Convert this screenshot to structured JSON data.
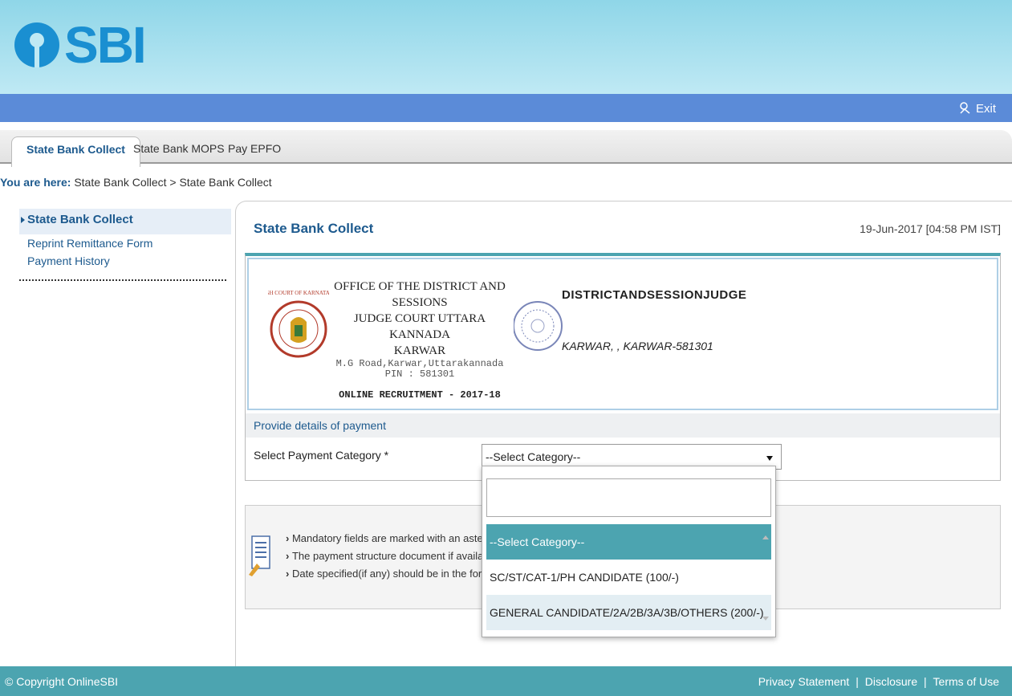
{
  "header": {
    "logo_text": "SBI",
    "exit_label": "Exit"
  },
  "tabs": [
    {
      "label": "State Bank Collect",
      "active": true
    },
    {
      "label": "State Bank MOPS",
      "active": false
    },
    {
      "label": "Pay EPFO",
      "active": false
    }
  ],
  "breadcrumb": {
    "label": "You are here:",
    "path": "State Bank Collect > State Bank Collect"
  },
  "sidebar": {
    "items": [
      {
        "label": "State Bank Collect",
        "active": true
      },
      {
        "label": "Reprint Remittance Form",
        "active": false
      },
      {
        "label": "Payment History",
        "active": false
      }
    ]
  },
  "main": {
    "title": "State Bank Collect",
    "date": "19-Jun-2017 [04:58 PM IST]",
    "office": {
      "line1": "OFFICE OF THE  DISTRICT AND SESSIONS",
      "line2": "JUDGE COURT UTTARA KANNADA",
      "line3": "KARWAR",
      "address1": "M.G Road,Karwar,Uttarakannada",
      "address2": "PIN : 581301",
      "recruitment": "ONLINE RECRUITMENT - 2017-18",
      "seal_text": "HIGH COURT OF KARNATAKA"
    },
    "department": "DISTRICTANDSESSIONJUDGE",
    "address": "KARWAR, , KARWAR-581301",
    "provide_label": "Provide details of payment",
    "category_label": "Select Payment Category *",
    "category_value": "--Select Category--",
    "notes": [
      "Mandatory fields are marked with an asteris",
      "The payment structure document if available",
      "Date specified(if any) should be in the forma"
    ]
  },
  "dropdown": {
    "search_value": "",
    "options": [
      {
        "label": "--Select Category--",
        "state": "selected"
      },
      {
        "label": "SC/ST/CAT-1/PH CANDIDATE (100/-)",
        "state": "normal"
      },
      {
        "label": "GENERAL CANDIDATE/2A/2B/3A/3B/OTHERS (200/-)",
        "state": "hover"
      }
    ]
  },
  "footer": {
    "copyright": "© Copyright OnlineSBI",
    "links": [
      "Privacy Statement",
      "Disclosure",
      "Terms of Use"
    ],
    "separator": "|"
  },
  "colors": {
    "accent": "#4ca4b0",
    "header_blue": "#5b8bd8",
    "link": "#1d5a8e",
    "sbi_blue": "#1a8fd1"
  },
  "icons": {
    "exit": "exit-icon",
    "note": "document-note-icon",
    "caret": "caret-down-icon"
  }
}
